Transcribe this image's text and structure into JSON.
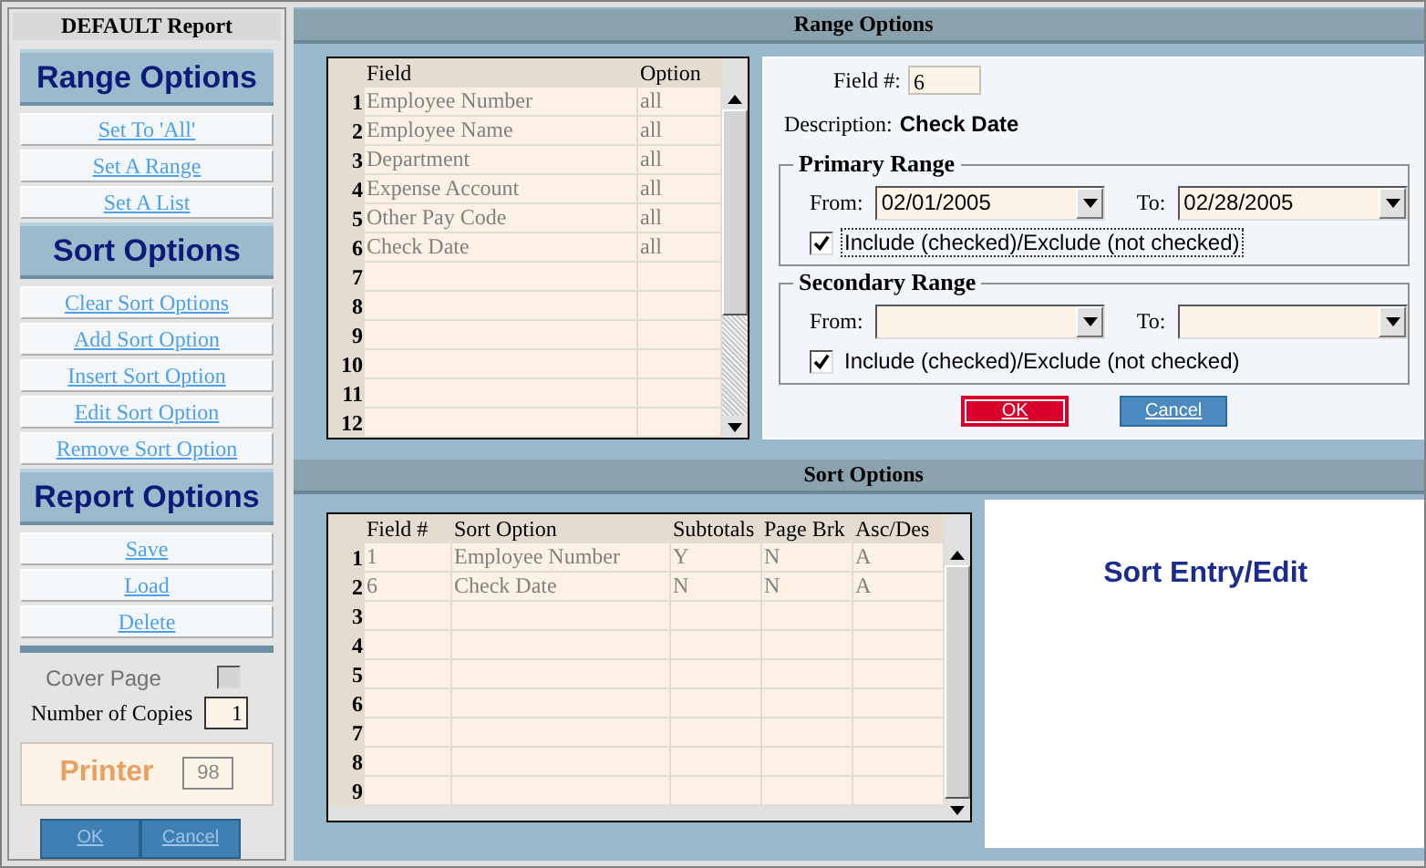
{
  "left_panel": {
    "title": "DEFAULT Report",
    "sections": [
      {
        "heading": "Range Options",
        "buttons": [
          "Set To 'All'",
          "Set A Range",
          "Set A List"
        ]
      },
      {
        "heading": "Sort Options",
        "buttons": [
          "Clear Sort Options",
          "Add Sort Option",
          "Insert Sort Option",
          "Edit Sort Option",
          "Remove Sort Option"
        ]
      },
      {
        "heading": "Report Options",
        "buttons": [
          "Save",
          "Load",
          "Delete"
        ]
      }
    ],
    "cover_page": {
      "label": "Cover Page",
      "checked": false
    },
    "copies": {
      "label": "Number of Copies",
      "value": "1"
    },
    "printer": {
      "label": "Printer",
      "value": "98"
    },
    "buttons": [
      "OK",
      "Cancel"
    ]
  },
  "range_options": {
    "title": "Range Options",
    "table": {
      "columns": [
        "Field",
        "Option"
      ],
      "rows": [
        {
          "number": "1",
          "cells": [
            "Employee Number",
            "all"
          ]
        },
        {
          "number": "2",
          "cells": [
            "Employee Name",
            "all"
          ]
        },
        {
          "number": "3",
          "cells": [
            "Department",
            "all"
          ]
        },
        {
          "number": "4",
          "cells": [
            "Expense Account",
            "all"
          ]
        },
        {
          "number": "5",
          "cells": [
            "Other Pay Code",
            "all"
          ]
        },
        {
          "number": "6",
          "cells": [
            "Check Date",
            "all"
          ]
        },
        {
          "number": "7",
          "cells": []
        },
        {
          "number": "8",
          "cells": []
        },
        {
          "number": "9",
          "cells": []
        },
        {
          "number": "10",
          "cells": []
        },
        {
          "number": "11",
          "cells": []
        },
        {
          "number": "12",
          "cells": []
        }
      ]
    },
    "field_label": "Field #:",
    "field_value": "6",
    "description_label": "Description:",
    "description_value": "Check Date",
    "ranges": [
      {
        "title": "Primary Range",
        "from_label": "From:",
        "from": "02/01/2005",
        "to_label": "To:",
        "to": "02/28/2005",
        "include_label": "Include (checked)/Exclude (not checked)",
        "include": true,
        "focused": true
      },
      {
        "title": "Secondary Range",
        "from_label": "From:",
        "to_label": "To:",
        "include_label": "Include (checked)/Exclude (not checked)",
        "include": true,
        "focused": false
      }
    ],
    "buttons": [
      {
        "label": "OK",
        "kind": "primary"
      },
      {
        "label": "Cancel",
        "kind": "normal"
      }
    ]
  },
  "sort_options": {
    "title": "Sort Options",
    "table": {
      "columns": [
        "Field #",
        "Sort Option",
        "Subtotals",
        "Page Brk",
        "Asc/Des"
      ],
      "rows": [
        {
          "number": "1",
          "cells": [
            "1",
            "Employee Number",
            "Y",
            "N",
            "A"
          ]
        },
        {
          "number": "2",
          "cells": [
            "6",
            "Check Date",
            "N",
            "N",
            "A"
          ]
        },
        {
          "number": "3",
          "cells": []
        },
        {
          "number": "4",
          "cells": []
        },
        {
          "number": "5",
          "cells": []
        },
        {
          "number": "6",
          "cells": []
        },
        {
          "number": "7",
          "cells": []
        },
        {
          "number": "8",
          "cells": []
        },
        {
          "number": "9",
          "cells": []
        }
      ]
    },
    "entry_title": "Sort Entry/Edit"
  }
}
